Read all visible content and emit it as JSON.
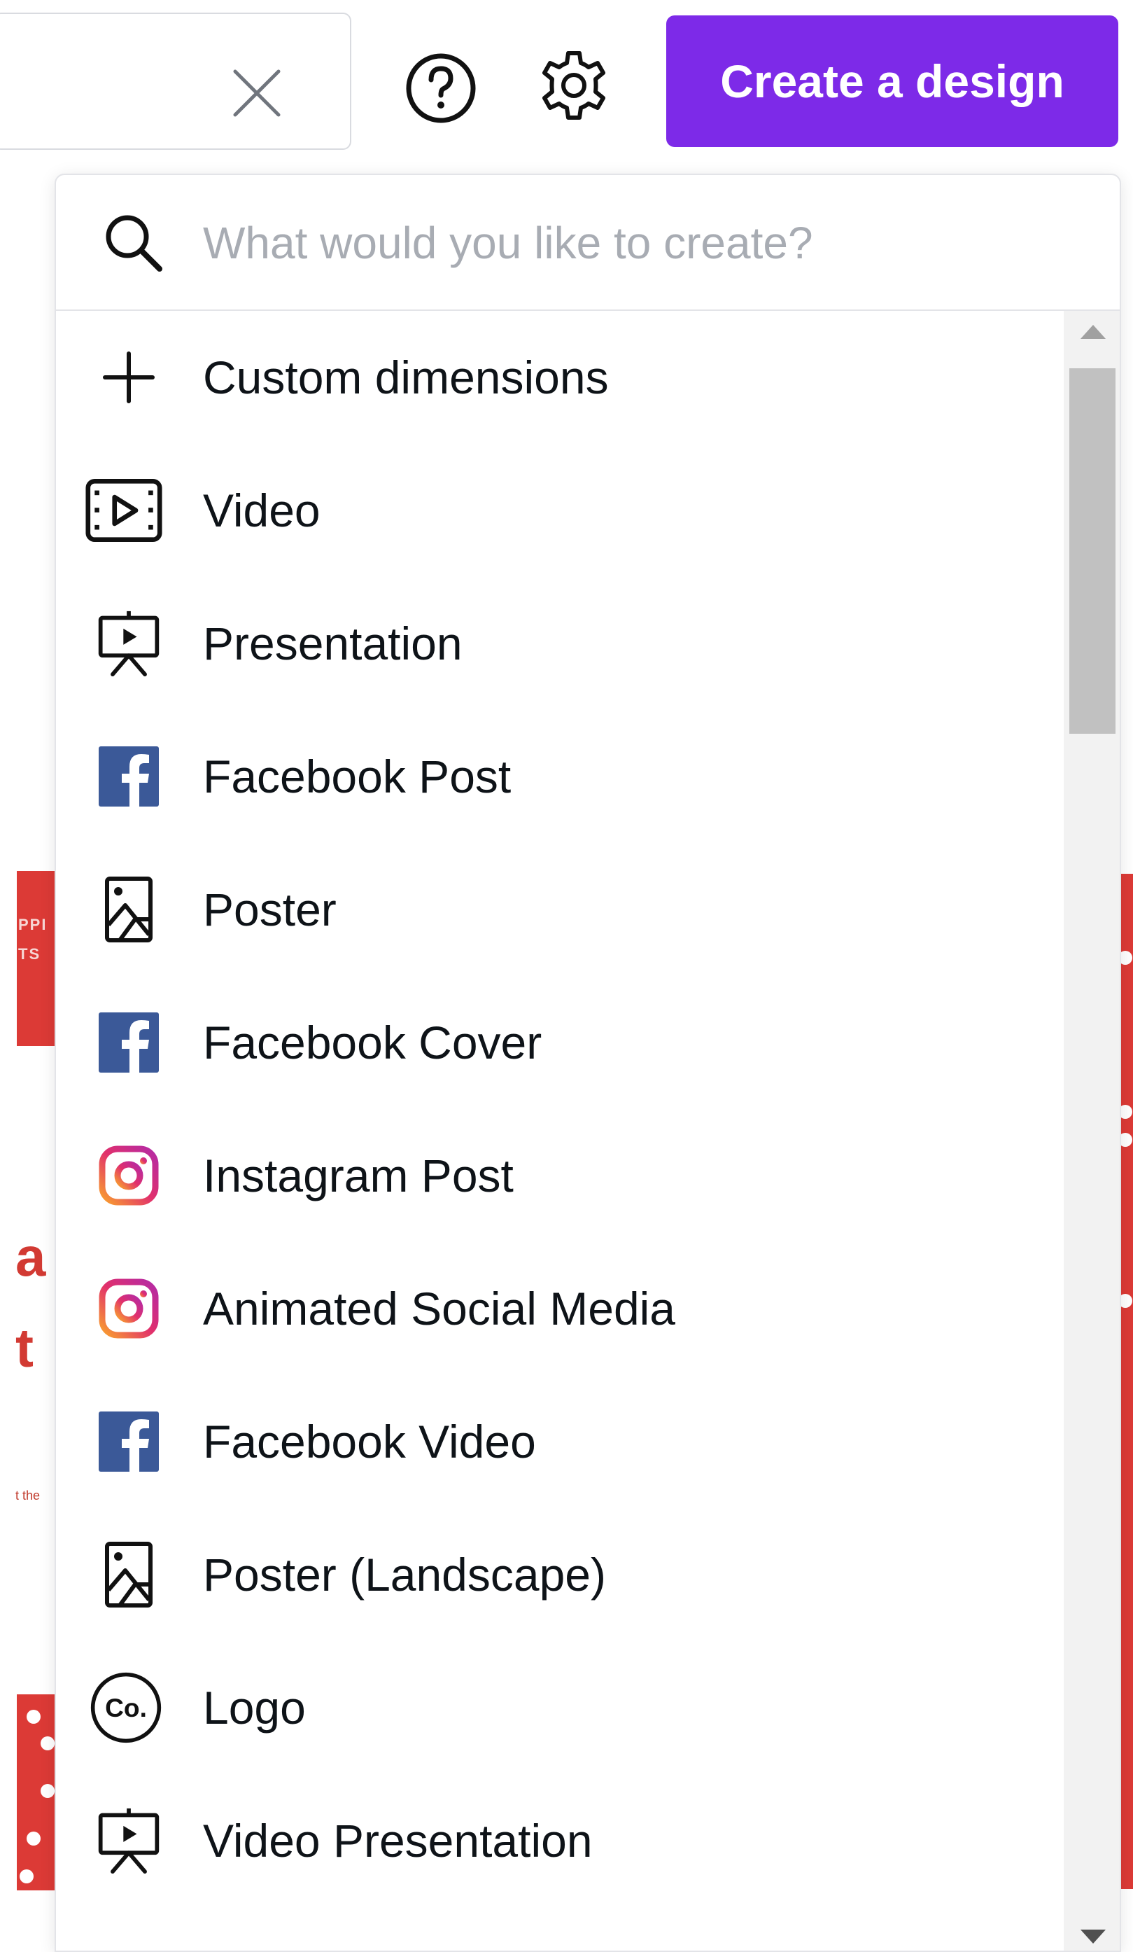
{
  "header": {
    "create_button_label": "Create a design",
    "accent_color": "#7d2ae8",
    "icons": [
      "close-icon",
      "help-icon",
      "gear-icon"
    ]
  },
  "dropdown": {
    "search_placeholder": "What would you like to create?",
    "items": [
      {
        "label": "Custom dimensions",
        "icon": "plus-icon"
      },
      {
        "label": "Video",
        "icon": "video-icon"
      },
      {
        "label": "Presentation",
        "icon": "presentation-icon"
      },
      {
        "label": "Facebook Post",
        "icon": "facebook-icon"
      },
      {
        "label": "Poster",
        "icon": "poster-icon"
      },
      {
        "label": "Facebook Cover",
        "icon": "facebook-icon"
      },
      {
        "label": "Instagram Post",
        "icon": "instagram-icon"
      },
      {
        "label": "Animated Social Media",
        "icon": "instagram-icon"
      },
      {
        "label": "Facebook Video",
        "icon": "facebook-icon"
      },
      {
        "label": "Poster (Landscape)",
        "icon": "poster-icon"
      },
      {
        "label": "Logo",
        "icon": "logo-icon"
      },
      {
        "label": "Video Presentation",
        "icon": "presentation-icon"
      }
    ]
  },
  "colors": {
    "facebook": "#3b5998",
    "instagram_gradient": [
      "#f9a12e",
      "#e1306c",
      "#b42aa6"
    ],
    "background_red": "#dc3a36"
  }
}
